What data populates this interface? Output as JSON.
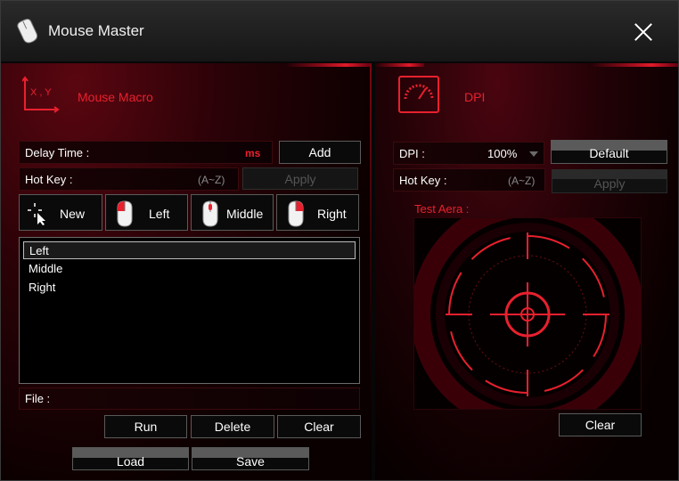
{
  "window": {
    "title": "Mouse Master",
    "close_icon": "close-icon"
  },
  "macro": {
    "section_title": "Mouse Macro",
    "icon_text": "X , Y",
    "delay_label": "Delay Time :",
    "delay_unit": "ms",
    "add_label": "Add",
    "hotkey_label": "Hot Key :",
    "hotkey_hint": "(A~Z)",
    "apply_label": "Apply",
    "buttons": [
      {
        "label": "New",
        "icon": "cursor-crosshair-icon"
      },
      {
        "label": "Left",
        "icon": "mouse-left-icon"
      },
      {
        "label": "Middle",
        "icon": "mouse-middle-icon"
      },
      {
        "label": "Right",
        "icon": "mouse-right-icon"
      }
    ],
    "list": [
      "Left",
      "Middle",
      "Right"
    ],
    "selected_index": 0,
    "file_label": "File :",
    "run_label": "Run",
    "delete_label": "Delete",
    "clear_label": "Clear",
    "load_label": "Load",
    "save_label": "Save"
  },
  "dpi": {
    "section_title": "DPI",
    "icon": "speedometer-icon",
    "dpi_label": "DPI :",
    "dpi_value": "100%",
    "default_label": "Default",
    "hotkey_label": "Hot Key :",
    "hotkey_hint": "(A~Z)",
    "apply_label": "Apply",
    "test_area_label": "Test Aera :",
    "clear_label": "Clear"
  },
  "colors": {
    "accent": "#e8202e",
    "hint": "#8a8a8a",
    "background": "#070707"
  }
}
